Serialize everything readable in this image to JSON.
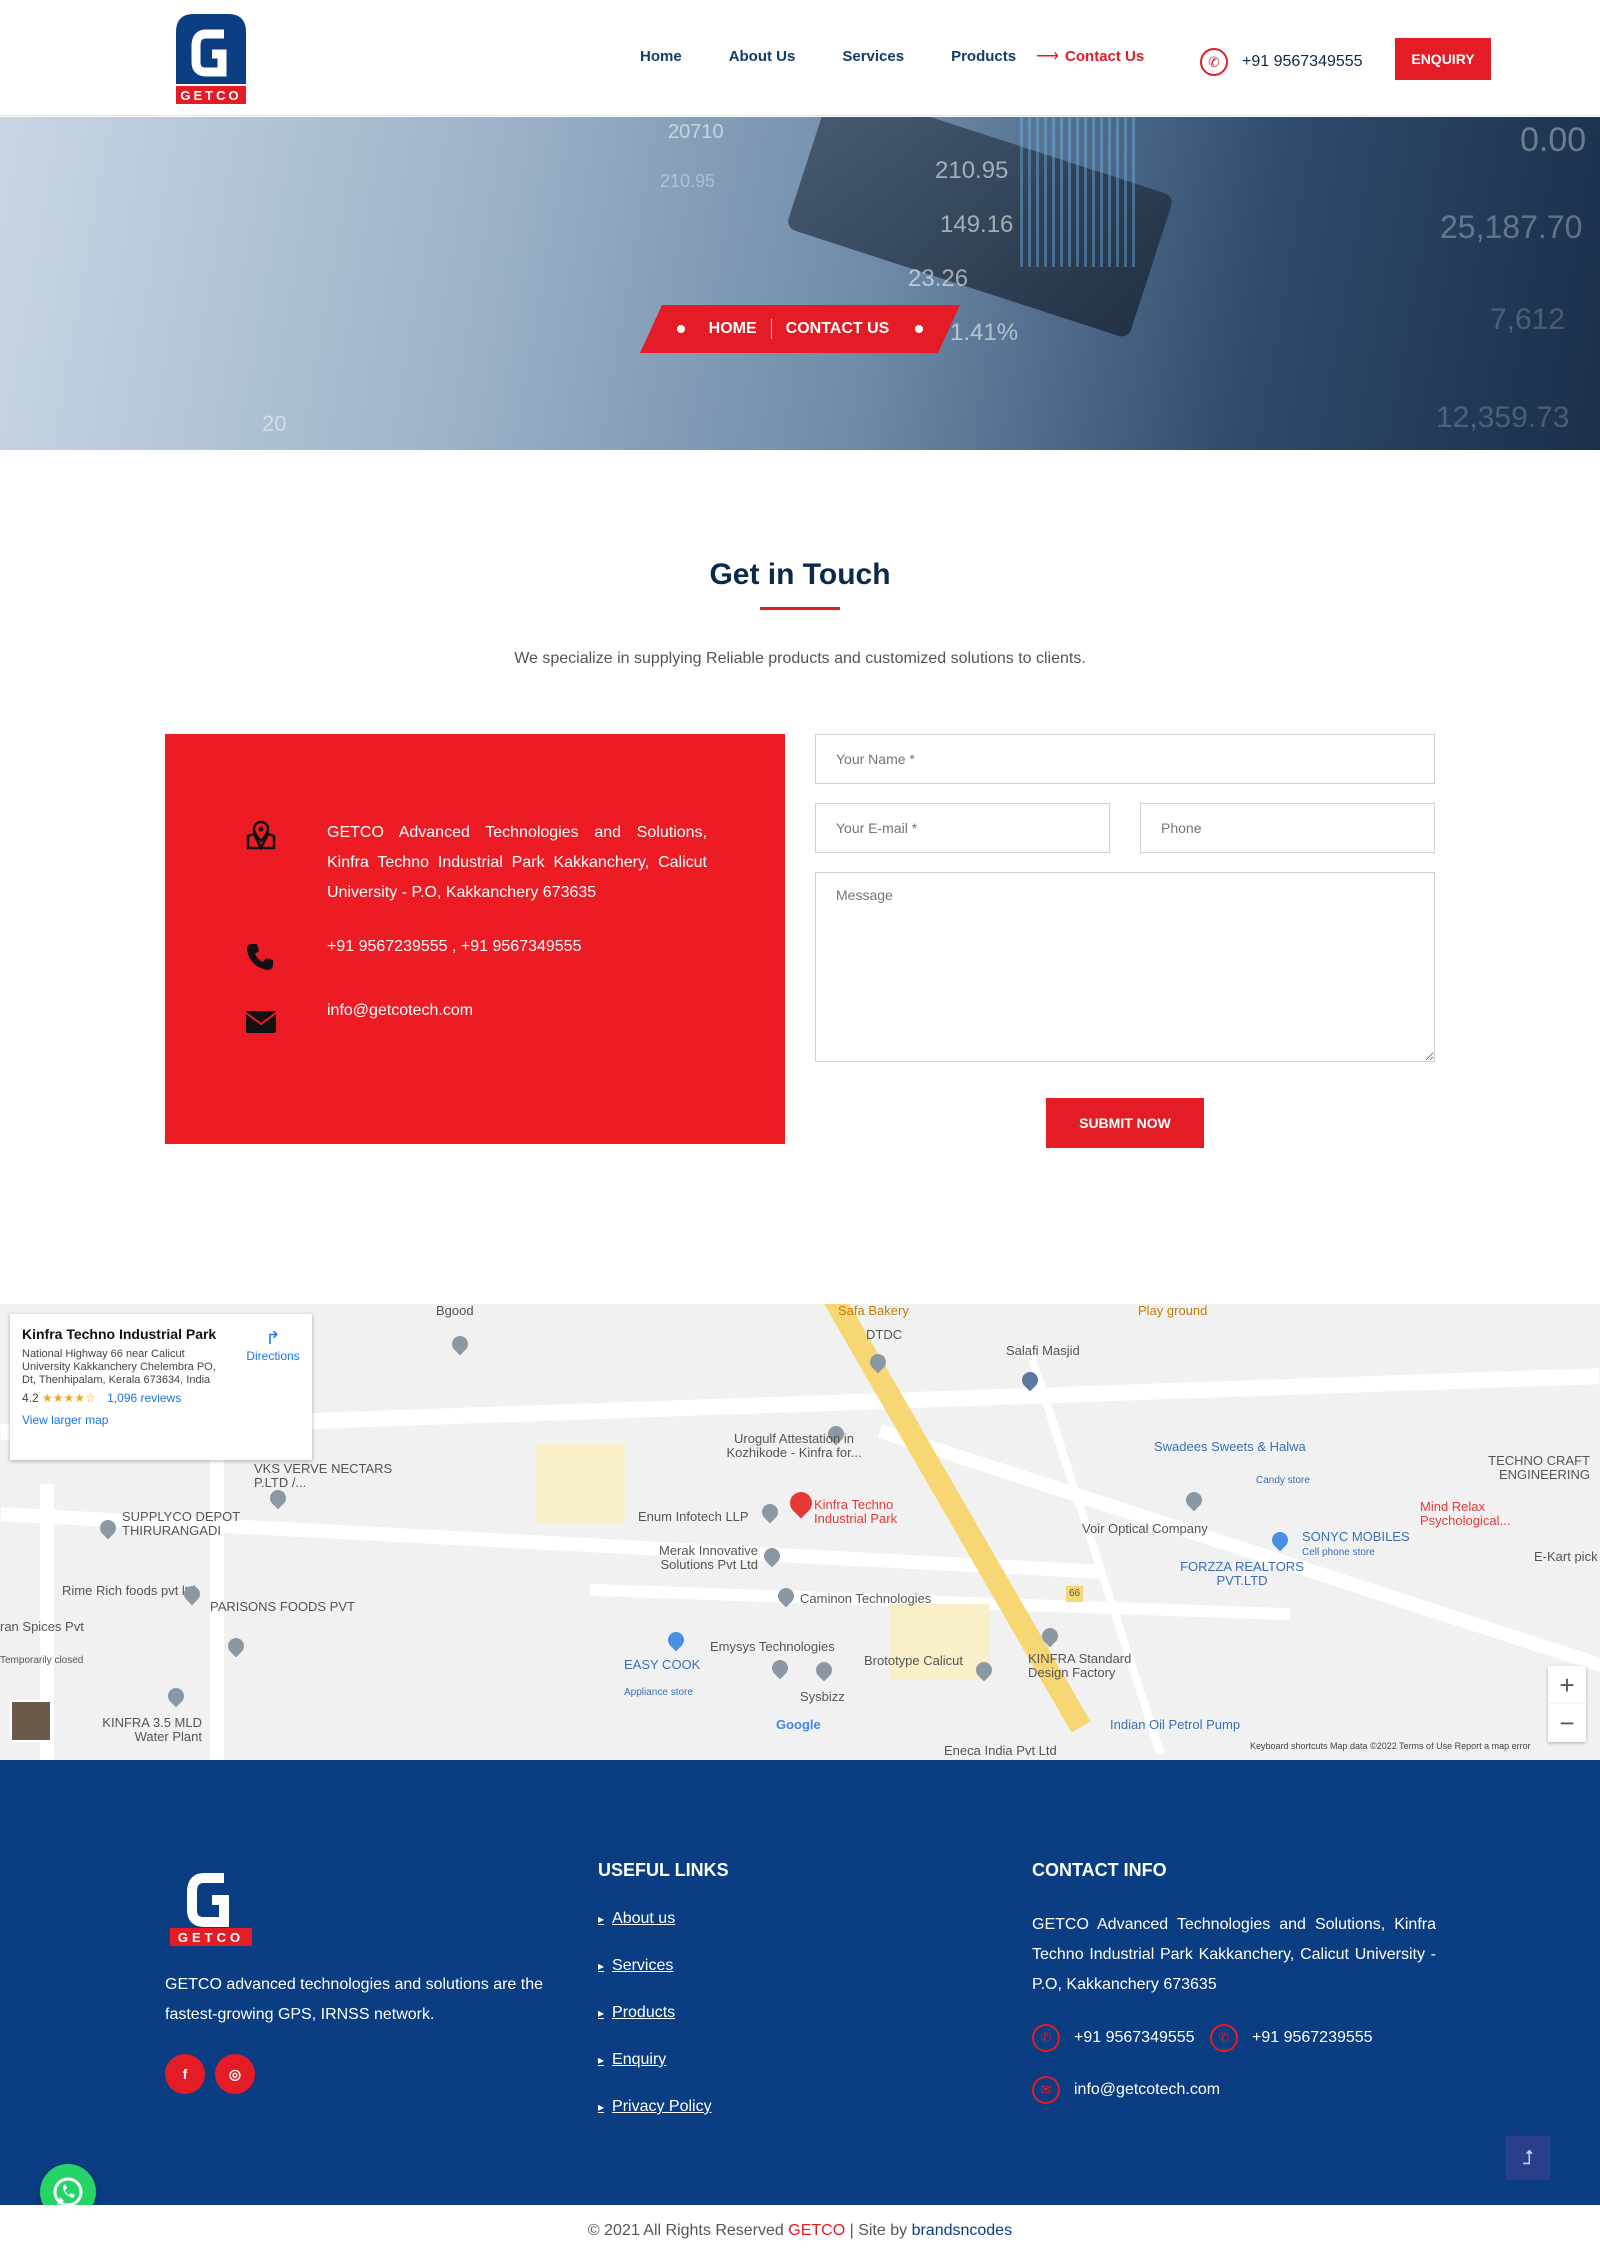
{
  "brand": {
    "logo_text": "GETCO",
    "primary": "#e31c25",
    "navy": "#0a3d82"
  },
  "nav": {
    "items": [
      {
        "label": "Home"
      },
      {
        "label": "About Us"
      },
      {
        "label": "Services"
      },
      {
        "label": "Products"
      },
      {
        "label": "Contact Us"
      }
    ],
    "phone": "+91 9567349555",
    "enquiry": "ENQUIRY"
  },
  "hero": {
    "numbers": [
      "20710",
      "210.95",
      "149.16",
      "23.26",
      "1.41%",
      "0.00",
      "25,187.70",
      "7,612",
      "12,359.73",
      "20",
      "210.95"
    ],
    "breadcrumb": {
      "home": "HOME",
      "current": "CONTACT US"
    }
  },
  "touch": {
    "title": "Get in Touch",
    "subtitle": "We specialize in supplying Reliable products and customized solutions to clients.",
    "address": "GETCO Advanced Technologies and Solutions, Kinfra Techno Industrial Park Kakkanchery, Calicut University - P.O, Kakkanchery 673635",
    "phones": "+91 9567239555 , +91 9567349555",
    "email": "info@getcotech.com"
  },
  "form": {
    "name_placeholder": "Your Name *",
    "email_placeholder": "Your E-mail *",
    "phone_placeholder": "Phone",
    "message_placeholder": "Message",
    "submit": "SUBMIT NOW"
  },
  "map": {
    "card": {
      "title": "Kinfra Techno Industrial Park",
      "address": "National Highway 66 near Calicut University Kakkanchery Chelembra PO, Dt, Thenhipalam, Kerala 673634, India",
      "rating": "4.2",
      "stars": "★★★★☆",
      "reviews": "1,096 reviews",
      "larger": "View larger map",
      "directions": "Directions"
    },
    "labels": [
      "Bgood",
      "Safa Bakery",
      "DTDC",
      "Salafi Masjid",
      "Play ground",
      "Swadees Sweets & Halwa",
      "Candy store",
      "TECHNO CRAFT ENGINEERING",
      "Urogulf Attestation in Kozhikode - Kinfra for...",
      "VKS VERVE NECTARS P.LTD /...",
      "SUPPLYCO DEPOT THIRURANGADI",
      "Enum Infotech LLP",
      "Kinfra Techno Industrial Park",
      "Voir Optical Company",
      "SONYC MOBILES",
      "Cell phone store",
      "Mind Relax Psychological...",
      "E-Kart pick",
      "Merak Innovative Solutions Pvt Ltd",
      "FORZZA REALTORS PVT.LTD",
      "Rime Rich foods pvt ltd",
      "PARISONS FOODS PVT",
      "Caminon Technologies",
      "ran Spices Pvt",
      "Temporarily closed",
      "Emysys Technologies",
      "EASY COOK",
      "Appliance store",
      "Brototype Calicut",
      "KINFRA Standard Design Factory",
      "Sysbizz",
      "KINFRA 3.5 MLD Water Plant",
      "Indian Oil Petrol Pump",
      "Eneca India Pvt Ltd",
      "Google",
      "66"
    ],
    "footer": "Keyboard shortcuts    Map data ©2022    Terms of Use    Report a map error"
  },
  "footer": {
    "about": "GETCO advanced technologies and solutions are the fastest-growing GPS, IRNSS network.",
    "useful_title": "USEFUL LINKS",
    "links": [
      "About us",
      "Services",
      "Products",
      "Enquiry",
      "Privacy Policy"
    ],
    "contact_title": "CONTACT INFO",
    "address": "GETCO Advanced Technologies and Solutions, Kinfra Techno Industrial Park Kakkanchery, Calicut University - P.O, Kakkanchery 673635",
    "phone1": "+91 9567349555",
    "phone2": "+91 9567239555",
    "email": "info@getcotech.com",
    "social": [
      "f",
      "◎"
    ]
  },
  "copyright": {
    "prefix": "© 2021 All Rights Reserved",
    "brand": "GETCO",
    "mid": "| Site by",
    "site": "brandsncodes"
  }
}
